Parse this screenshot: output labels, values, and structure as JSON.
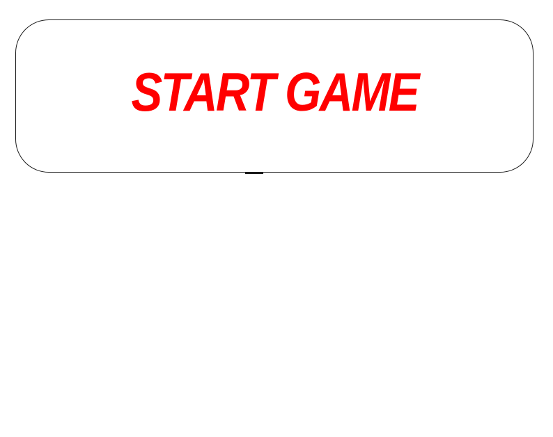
{
  "start_button": {
    "label": "START GAME",
    "label_color": "#ff0000",
    "background_color": "#ffffff",
    "border_color": "#1a1a1a"
  },
  "screen": {
    "background_color": "#ffffff"
  }
}
